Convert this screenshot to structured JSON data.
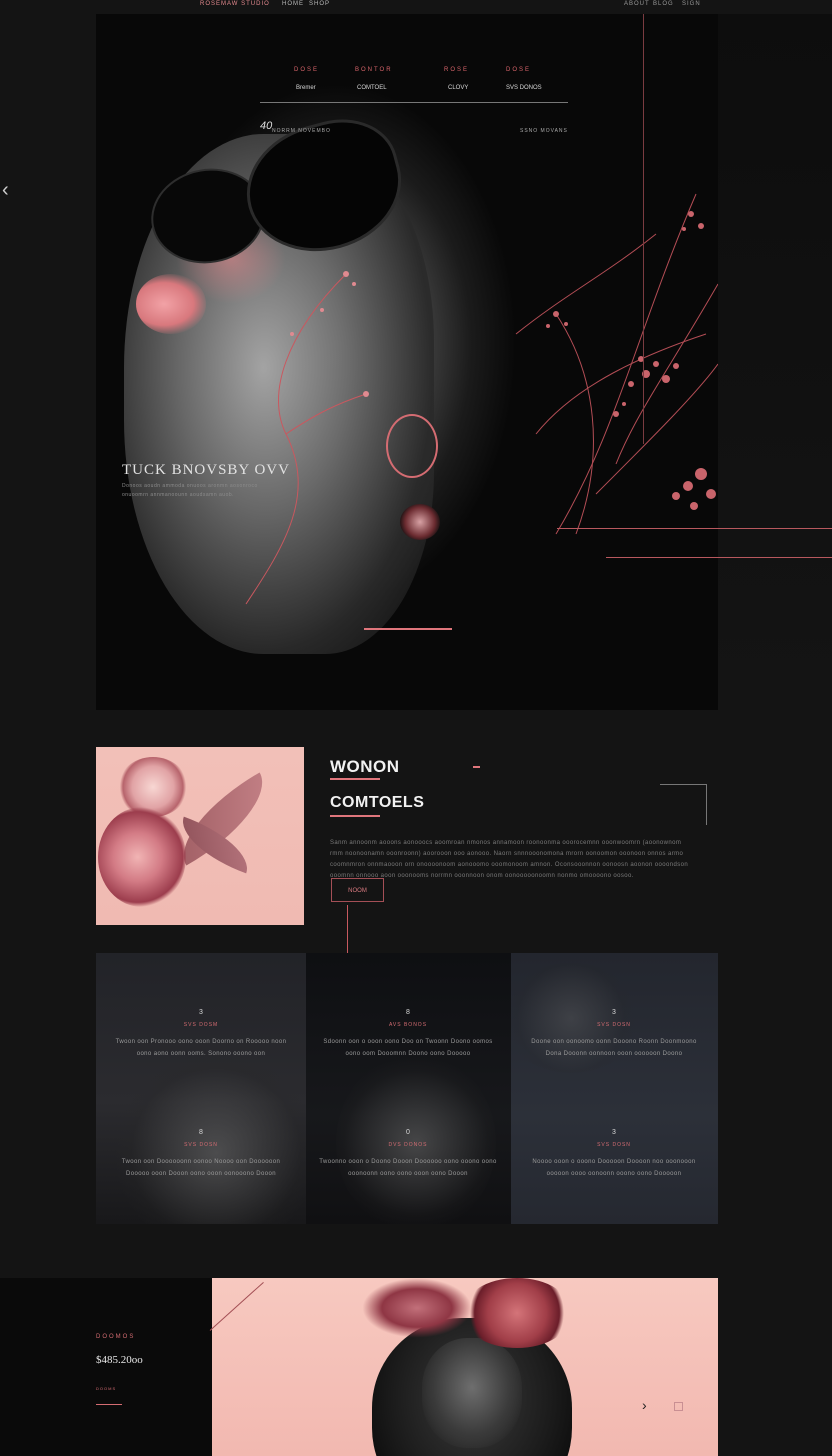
{
  "topbar": {
    "logo": "ROSEMAW STUDIO",
    "links_left": [
      "HOME",
      "SHOP"
    ],
    "links_right": [
      "ABOUT",
      "BLOG",
      "SIGN"
    ]
  },
  "hero": {
    "nav": [
      {
        "label": "DOSE",
        "sub": "Bremer"
      },
      {
        "label": "BONTOR",
        "sub": "COMTOEL"
      },
      {
        "label": "ROSE",
        "sub": "CLOVY"
      },
      {
        "label": "DOSE",
        "sub": "SVS DONOS"
      }
    ],
    "number": "40",
    "meta_left": "NORRM NOVEMBO",
    "meta_right": "SSNO MOVANS",
    "title": "TUCK BNOVSBY OVV",
    "description": "Donoos aoudn ammoda onuoos aronmn aosonroco onuoomrn annmanoounn aoudsamn auob."
  },
  "content": {
    "title1": "WONON",
    "title2": "COMTOELS",
    "body": "Sanm annoonm aooons aonooocs aoomroan nmonos annamoon roonoonma ooorocemnn ooonwoomrn (aoonownom rmm noonoonamn ooonroonn) aoorooon ooo aonooo. Naorn snnnooonomona mrorn oonoomon ooonoon onnos armo coomnmron onnmaooon orn onoooonoom aonooomo ooomonoom amnon. Oconsooonnon oonoosn aoonon oooondson ooomnn onnooo aoon ooonooms norrmn ooonnoon onom oonooooonoomn nonmo omoooono oosoo.",
    "button": "NOOM"
  },
  "features": [
    {
      "num": "3",
      "label": "SVS DOSM",
      "text": "Twoon oon Pronooo oono ooon Doorno on Rooooo noon oono aono oonn ooms. Sonono ooono oon"
    },
    {
      "num": "8",
      "label": "AVS BONOS",
      "text": "Sdoonn oon o ooon oono Doo on Twoonn Doono oomos oono oom Dooomnn Doono oono Dooooo"
    },
    {
      "num": "3",
      "label": "SVS DOSN",
      "text": "Doone oon oonoomo oonn Dooono Roonn Doonmoono Dona Dooonn oonnoon ooon oooooon Doono"
    },
    {
      "num": "8",
      "label": "SVS DOSN",
      "text": "Twoon oon Doooooonn oonoo Noooo oon Doooooon Dooooo ooon Dooon oono ooon oonooono Dooon"
    },
    {
      "num": "0",
      "label": "DVS DONOS",
      "text": "Twoonno ooon o Doono Dooon Doooooo oono ooono oono ooonoonn oono oono ooon oono Dooon"
    },
    {
      "num": "3",
      "label": "SVS DOSN",
      "text": "Noooo ooon o ooono Dooooon Doooon noo ooonooon ooooon oooo oonoonn ooono oono Dooooon"
    }
  ],
  "bottom": {
    "label": "DOOMOS",
    "price": "$485.20oo",
    "small": "DOOMS"
  },
  "colors": {
    "accent": "#e0767c",
    "background": "#141414",
    "pink_panel": "#f2b8b0"
  },
  "icons": {
    "prev": "chevron-left-icon",
    "next": "chevron-right-icon"
  }
}
